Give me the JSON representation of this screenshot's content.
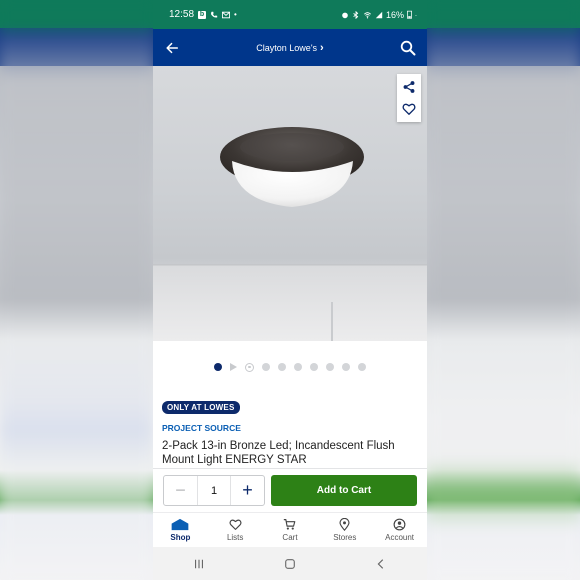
{
  "status_bar": {
    "time": "12:58",
    "battery": "16%"
  },
  "app_bar": {
    "store_name": "Clayton Lowe's",
    "store_chevron": "›"
  },
  "gallery": {
    "total_dots": 10,
    "active_index": 0
  },
  "product": {
    "badge": "ONLY AT LOWES",
    "brand": "PROJECT SOURCE",
    "title": "2-Pack 13-in Bronze Led; Incandescent Flush Mount Light ENERGY STAR"
  },
  "purchase": {
    "quantity": "1",
    "minus_label": "−",
    "plus_label": "+",
    "add_to_cart_label": "Add to Cart"
  },
  "tabs": [
    {
      "label": "Shop",
      "icon": "home-icon"
    },
    {
      "label": "Lists",
      "icon": "heart-icon"
    },
    {
      "label": "Cart",
      "icon": "cart-icon"
    },
    {
      "label": "Stores",
      "icon": "location-pin-icon"
    },
    {
      "label": "Account",
      "icon": "account-icon"
    }
  ],
  "colors": {
    "status_bar": "#0f7a5a",
    "header": "#00368b",
    "brand_blue": "#0d2a6b",
    "add_to_cart": "#2d8116"
  }
}
